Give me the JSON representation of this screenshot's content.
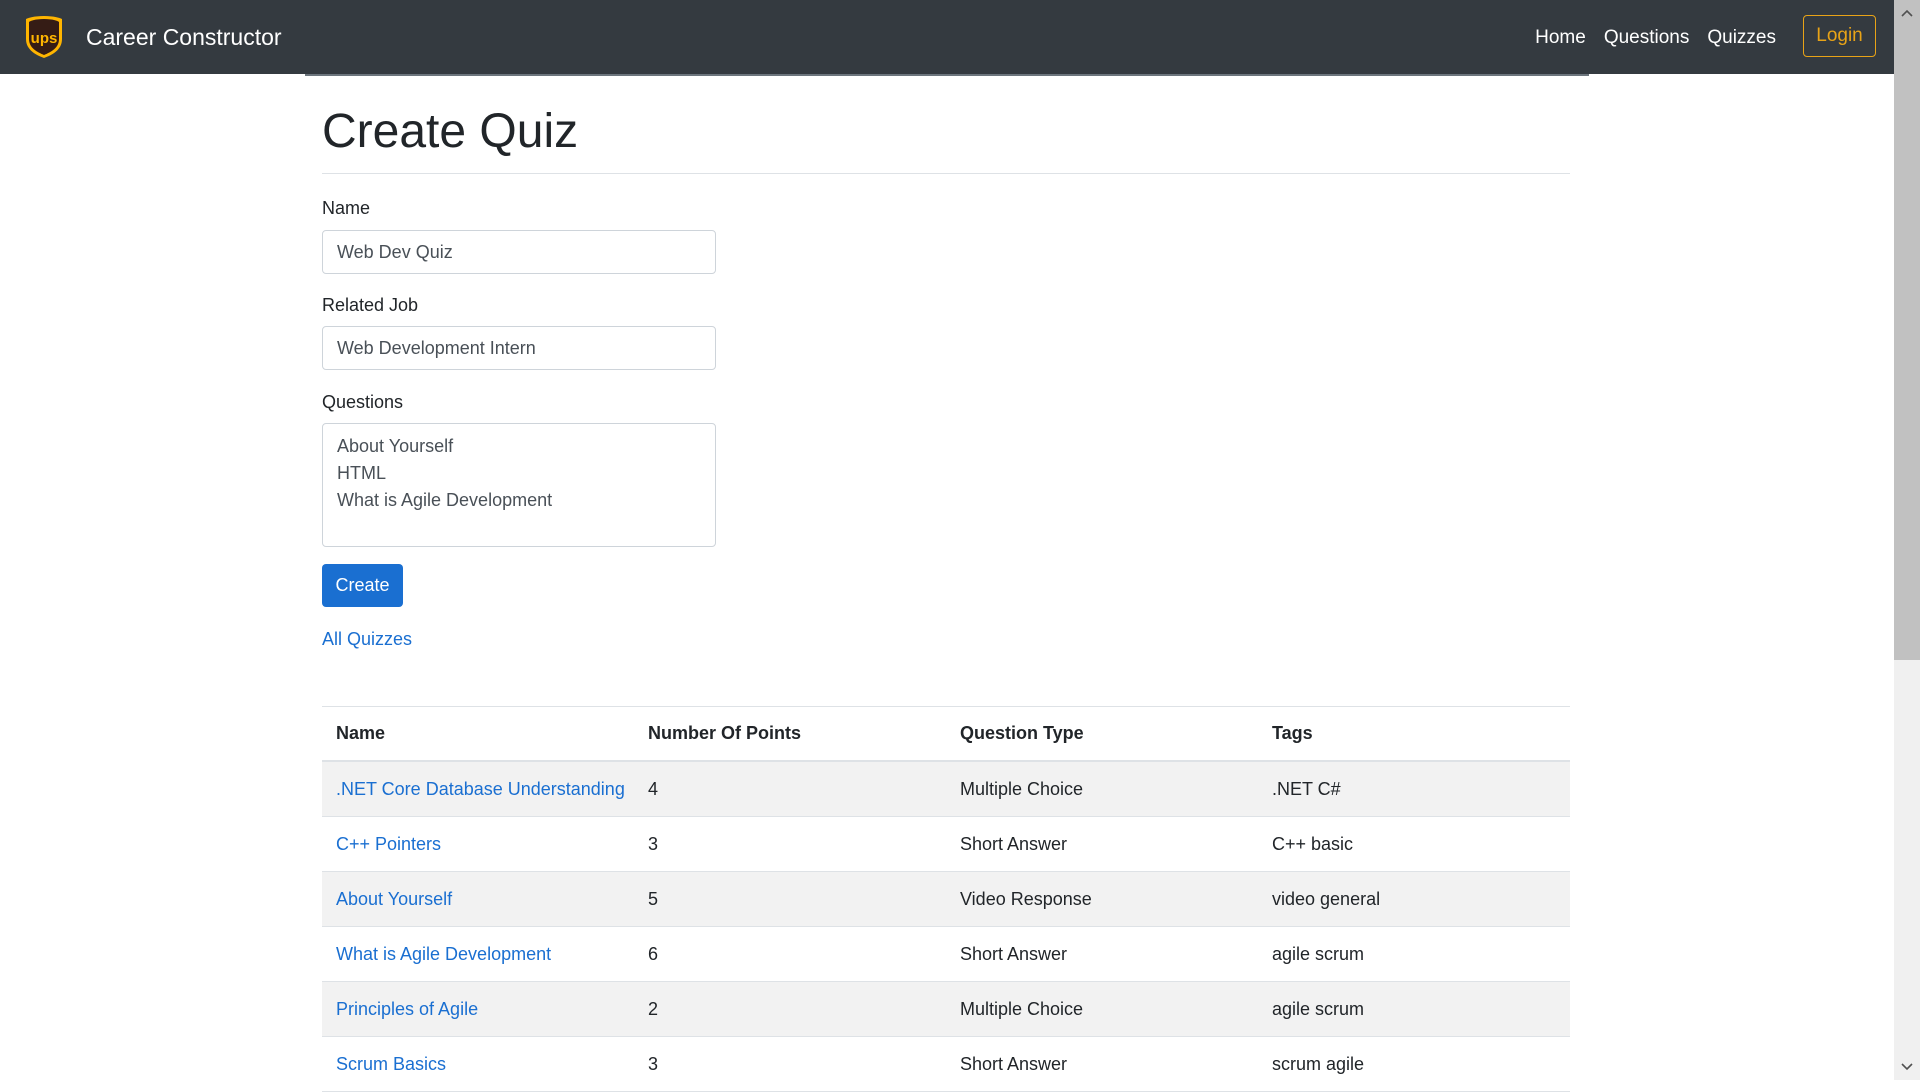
{
  "navbar": {
    "brand_name": "Career Constructor",
    "logo_text": "ups",
    "logo_icon": "ups-shield-logo",
    "links": [
      "Home",
      "Questions",
      "Quizzes"
    ],
    "login_label": "Login"
  },
  "page": {
    "title": "Create Quiz"
  },
  "form": {
    "name_label": "Name",
    "name_value": "Web Dev Quiz",
    "job_label": "Related Job",
    "job_value": "Web Development Intern",
    "questions_label": "Questions",
    "questions_options": [
      "About Yourself",
      "HTML",
      "What is Agile Development"
    ],
    "create_label": "Create",
    "all_quizzes_label": "All Quizzes"
  },
  "table": {
    "headers": [
      "Name",
      "Number Of Points",
      "Question Type",
      "Tags"
    ],
    "rows": [
      {
        "name": ".NET Core Database Understanding",
        "points": "4",
        "type": "Multiple Choice",
        "tags": ".NET C#"
      },
      {
        "name": "C++ Pointers",
        "points": "3",
        "type": "Short Answer",
        "tags": "C++ basic"
      },
      {
        "name": "About Yourself",
        "points": "5",
        "type": "Video Response",
        "tags": "video general"
      },
      {
        "name": "What is Agile Development",
        "points": "6",
        "type": "Short Answer",
        "tags": "agile scrum"
      },
      {
        "name": "Principles of Agile",
        "points": "2",
        "type": "Multiple Choice",
        "tags": "agile scrum"
      },
      {
        "name": "Scrum Basics",
        "points": "3",
        "type": "Short Answer",
        "tags": "scrum agile"
      }
    ]
  },
  "colors": {
    "navbar_bg": "#343a40",
    "accent_blue": "#1a6fd1",
    "login_gold": "#e8a317",
    "logo_brown": "#351c15",
    "logo_gold": "#ffb500"
  }
}
